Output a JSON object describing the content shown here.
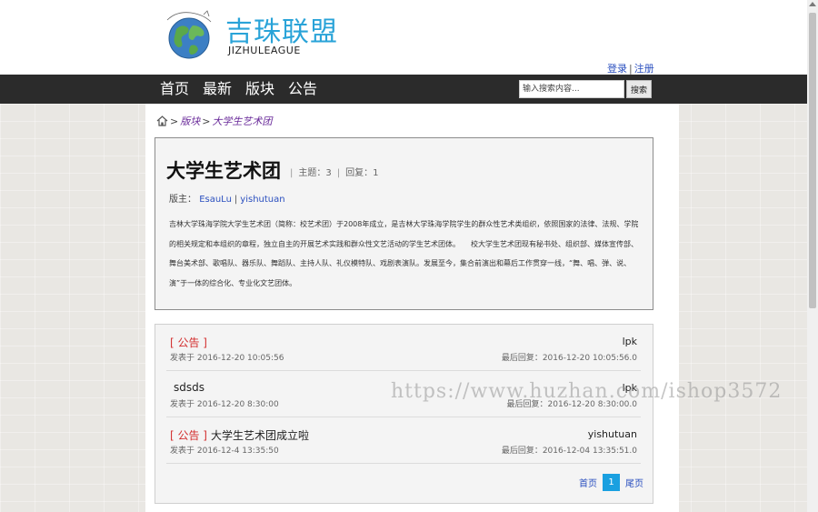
{
  "header": {
    "logo_title": "吉珠联盟",
    "logo_subtitle": "JIZHULEAGUE",
    "login_label": "登录",
    "auth_separator": "|",
    "register_label": "注册"
  },
  "nav": {
    "items": [
      "首页",
      "最新",
      "版块",
      "公告"
    ],
    "search_placeholder": "输入搜索内容...",
    "search_button": "搜索"
  },
  "breadcrumb": {
    "level1": "版块",
    "current": "大学生艺术团",
    "arrow": ">"
  },
  "board": {
    "title": "大学生艺术团",
    "topics_label": "主题：3",
    "replies_label": "回复：1",
    "separator": "|",
    "moderators_label": "版主：",
    "moderators": [
      "EsauLu",
      "yishutuan"
    ],
    "description": "吉林大学珠海学院大学生艺术团（简称：校艺术团）于2008年成立，是吉林大学珠海学院学生的群众性艺术类组织，依照国家的法律、法规、学院的相关规定和本组织的章程，独立自主的开展艺术实践和群众性文艺活动的学生艺术团体。　　校大学生艺术团现有秘书处、组织部、媒体宣传部、舞台美术部、歌唱队、器乐队、舞蹈队、主持人队、礼仪模特队、戏剧表演队。发展至今，集合前演出和幕后工作贯穿一线，“舞、唱、弹、说、演”于一体的综合化、专业化文艺团体。"
  },
  "topics": [
    {
      "tag": "[ 公告 ]",
      "title": "",
      "posted": "发表于 2016-12-20 10:05:56",
      "author": "lpk",
      "last_reply": "最后回复：2016-12-20 10:05:56.0"
    },
    {
      "tag": "",
      "title": "sdsds",
      "posted": "发表于 2016-12-20 8:30:00",
      "author": "lpk",
      "last_reply": "最后回复：2016-12-20 8:30:00.0"
    },
    {
      "tag": "[ 公告 ]",
      "title": "大学生艺术团成立啦",
      "posted": "发表于 2016-12-4 13:35:50",
      "author": "yishutuan",
      "last_reply": "最后回复：2016-12-04 13:35:51.0"
    }
  ],
  "pagination": {
    "first": "首页",
    "current": "1",
    "last": "尾页"
  },
  "watermark": "https://www.huzhan.com/ishop3572",
  "colors": {
    "nav_bg": "#2b2b2b",
    "brand_blue": "#29a3d8",
    "tag_red": "#d32f2f",
    "link_blue": "#2a4fbf",
    "page_active": "#1aa0e0"
  }
}
